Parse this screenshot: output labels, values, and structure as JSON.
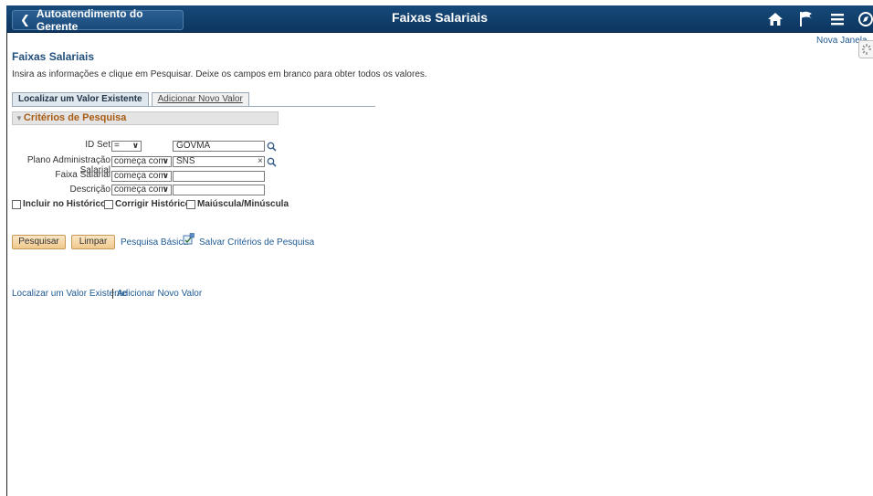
{
  "header": {
    "back_label": "Autoatendimento do Gerente",
    "title": "Faixas Salariais",
    "icons": [
      "home-icon",
      "flag-icon",
      "menu-icon",
      "navbar-icon"
    ]
  },
  "new_window_link": "Nova Janela",
  "page": {
    "heading": "Faixas Salariais",
    "instructions": "Insira as informações e clique em Pesquisar. Deixe os campos em branco para obter todos os valores."
  },
  "tabs": [
    {
      "label": "Localizar um Valor Existente",
      "active": true
    },
    {
      "label": "Adicionar Novo Valor",
      "active": false
    }
  ],
  "section_title": "Critérios de Pesquisa",
  "fields": [
    {
      "label": "ID Set",
      "operator": "=",
      "value": "GOVMA"
    },
    {
      "label": "Plano Administração Salarial",
      "operator": "começa com",
      "value": "SNS"
    },
    {
      "label": "Faixa Salarial",
      "operator": "começa com",
      "value": ""
    },
    {
      "label": "Descrição",
      "operator": "começa com",
      "value": ""
    }
  ],
  "checkboxes": [
    {
      "label": "Incluir no Histórico",
      "checked": false
    },
    {
      "label": "Corrigir Histórico",
      "checked": false
    },
    {
      "label": "Maiúscula/Minúscula",
      "checked": false
    }
  ],
  "buttons": {
    "search": "Pesquisar",
    "clear": "Limpar",
    "basic_search": "Pesquisa Básica",
    "save_criteria": "Salvar Critérios de Pesquisa"
  },
  "footer_links": {
    "find_existing": "Localizar um Valor Existente",
    "add_new": "Adicionar Novo Valor"
  },
  "colors": {
    "header_bg": "#164a7a",
    "link": "#1f5a92",
    "section_title": "#a85b12",
    "button_bg": "#f0c98c"
  }
}
